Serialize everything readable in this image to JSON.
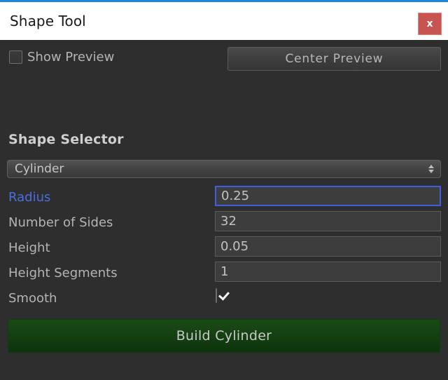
{
  "window": {
    "title": "Shape Tool",
    "close_label": "x",
    "accent_top_color": "#1b88e0",
    "titlebar_bg": "#ffffff",
    "close_bg": "#c75450",
    "body_bg": "#2e2e2e"
  },
  "toolbar": {
    "show_preview_label": "Show Preview",
    "show_preview_checked": false,
    "center_preview_label": "Center Preview"
  },
  "shape_selector": {
    "section_title": "Shape Selector",
    "selected": "Cylinder",
    "options": [
      "Cylinder"
    ]
  },
  "fields": [
    {
      "label": "Radius",
      "value": "0.25",
      "type": "text",
      "focused": true,
      "label_color": "#4a6ee0"
    },
    {
      "label": "Number of Sides",
      "value": "32",
      "type": "text",
      "focused": false,
      "label_color": "#b4b4b4"
    },
    {
      "label": "Height",
      "value": "0.05",
      "type": "text",
      "focused": false,
      "label_color": "#b4b4b4"
    },
    {
      "label": "Height Segments",
      "value": "1",
      "type": "text",
      "focused": false,
      "label_color": "#b4b4b4"
    },
    {
      "label": "Smooth",
      "value": "",
      "type": "checkbox",
      "checked": true,
      "label_color": "#b4b4b4"
    }
  ],
  "build": {
    "label": "Build Cylinder",
    "color": "#144011"
  }
}
